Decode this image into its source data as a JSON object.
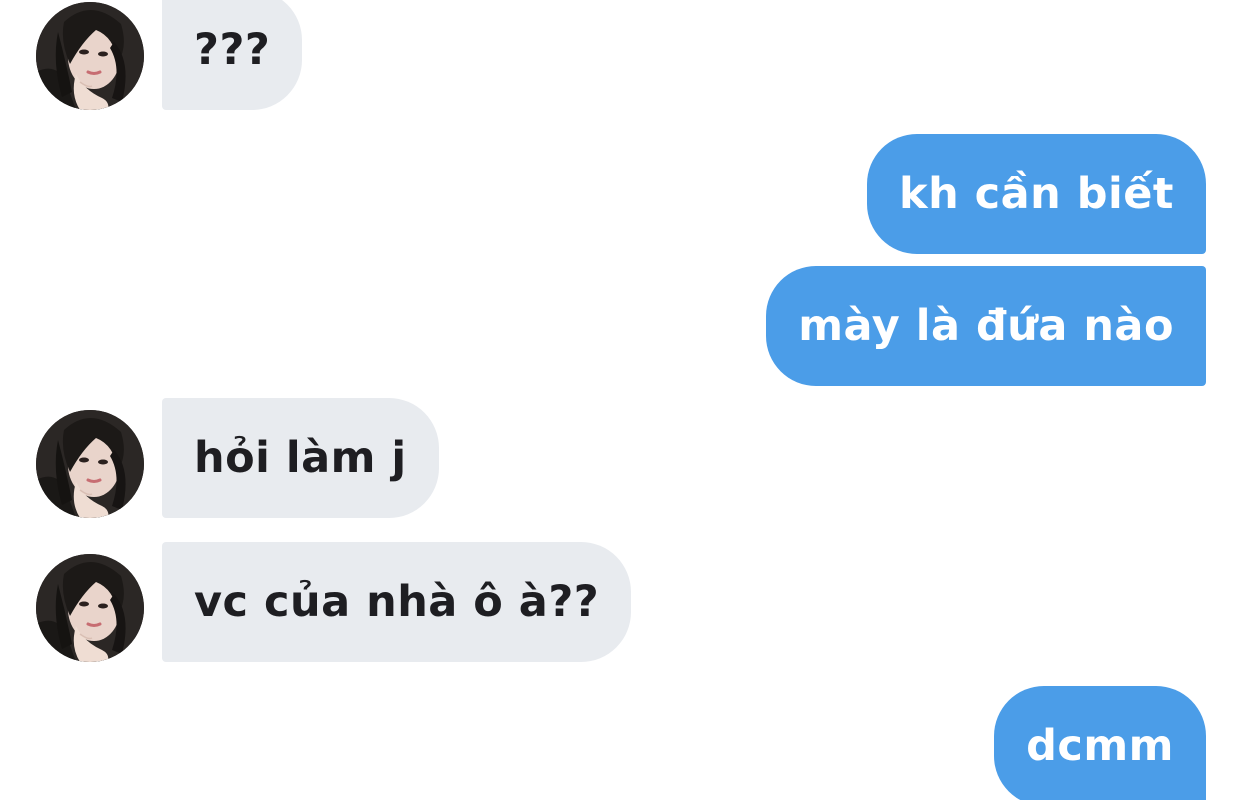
{
  "conversation": {
    "messages": [
      {
        "from": "contact",
        "text": "???"
      },
      {
        "from": "me",
        "text": "kh cần biết"
      },
      {
        "from": "me",
        "text": "mày là đứa nào"
      },
      {
        "from": "contact",
        "text": "hỏi làm j"
      },
      {
        "from": "contact",
        "text": "vc của nhà ô à??"
      },
      {
        "from": "me",
        "text": "dcmm"
      }
    ]
  },
  "contact": {
    "avatar_icon": "profile-photo-icon"
  },
  "colors": {
    "incoming_bubble": "#e8ebef",
    "incoming_text": "#1e1e22",
    "outgoing_bubble": "#4b9de8",
    "outgoing_text": "#ffffff",
    "background": "#ffffff"
  }
}
